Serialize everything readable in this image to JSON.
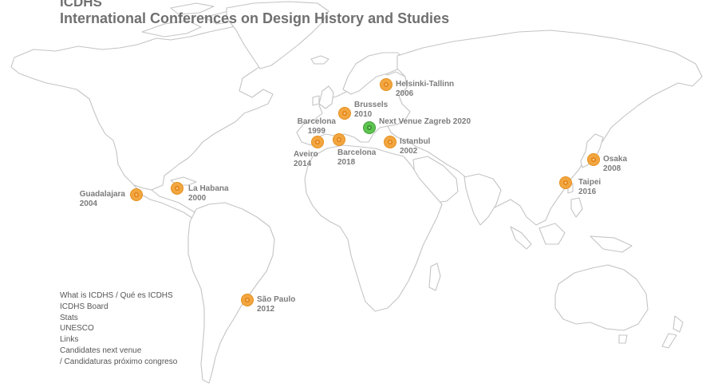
{
  "header": {
    "title": "ICDHS",
    "subtitle": "International Conferences on Design History and Studies"
  },
  "venues": [
    {
      "city": "Helsinki-Tallinn",
      "year": "2006"
    },
    {
      "city": "Brussels",
      "year": "2010"
    },
    {
      "city": "Next Venue Zagreb 2020",
      "year": ""
    },
    {
      "city": "Barcelona",
      "year": "1999"
    },
    {
      "city": "Aveiro",
      "year": "2014"
    },
    {
      "city": "Barcelona",
      "year": "2018"
    },
    {
      "city": "Istanbul",
      "year": "2002"
    },
    {
      "city": "Osaka",
      "year": "2008"
    },
    {
      "city": "Taipei",
      "year": "2016"
    },
    {
      "city": "Guadalajara",
      "year": "2004"
    },
    {
      "city": "La Habana",
      "year": "2000"
    },
    {
      "city": "São Paulo",
      "year": "2012"
    }
  ],
  "menu": [
    "What is ICDHS / Qué es ICDHS",
    "ICDHS Board",
    "Stats",
    "UNESCO",
    "Links",
    "Candidates next venue",
    "/ Candidaturas próximo congreso"
  ],
  "colors": {
    "past_venue": "#f2a640",
    "next_venue": "#5fc452",
    "land_outline": "#c4c4c4",
    "text": "#707070"
  }
}
